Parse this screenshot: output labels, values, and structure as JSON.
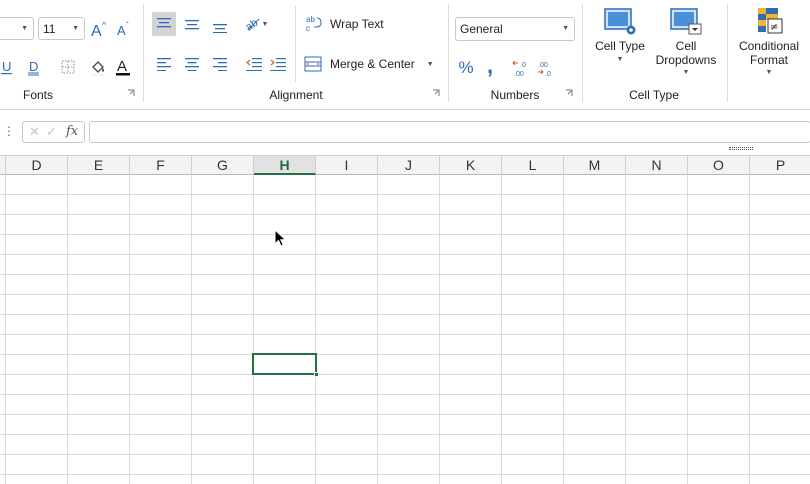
{
  "fonts": {
    "size_value": "11",
    "group_label": "Fonts"
  },
  "alignment": {
    "wrap_label": "Wrap Text",
    "wrap_icon_text": "ab c",
    "merge_label": "Merge & Center",
    "group_label": "Alignment"
  },
  "numbers": {
    "format_value": "General",
    "percent_glyph": "%",
    "comma_glyph": ",",
    "group_label": "Numbers"
  },
  "celltype": {
    "cell_type_label": "Cell Type",
    "cell_dropdowns_label_1": "Cell",
    "cell_dropdowns_label_2": "Dropdowns",
    "group_label": "Cell Type"
  },
  "conditional": {
    "label_1": "Conditional",
    "label_2": "Format"
  },
  "formula_bar": {
    "fx": "fx",
    "value": ""
  },
  "grid": {
    "columns": [
      "D",
      "E",
      "F",
      "G",
      "H",
      "I",
      "J",
      "K",
      "L",
      "M",
      "N",
      "O",
      "P"
    ],
    "active_column": "H"
  },
  "colors": {
    "accent_green": "#217346",
    "blue_icon": "#2e6db4"
  }
}
